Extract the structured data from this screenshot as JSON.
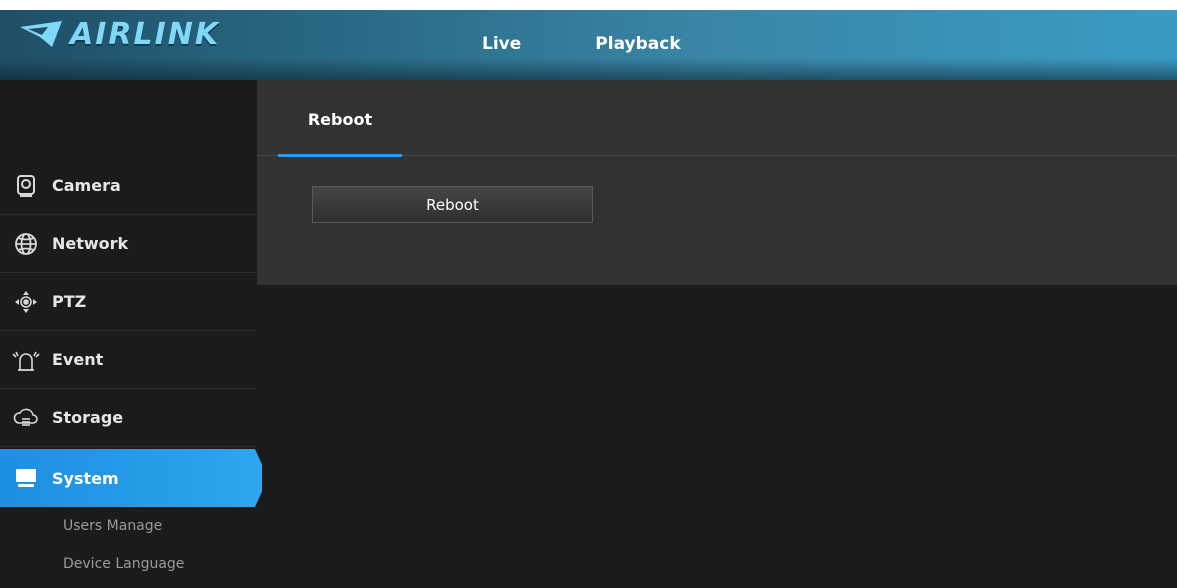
{
  "header": {
    "brand": "AIRLINK",
    "nav": [
      {
        "label": "Live"
      },
      {
        "label": "Playback"
      }
    ]
  },
  "sidebar": {
    "items": [
      {
        "label": "Camera",
        "icon": "camera-icon"
      },
      {
        "label": "Network",
        "icon": "globe-icon"
      },
      {
        "label": "PTZ",
        "icon": "ptz-icon"
      },
      {
        "label": "Event",
        "icon": "alarm-icon"
      },
      {
        "label": "Storage",
        "icon": "cloud-storage-icon"
      },
      {
        "label": "System",
        "icon": "monitor-icon",
        "active": true
      }
    ],
    "subitems": [
      {
        "label": "Users Manage"
      },
      {
        "label": "Device Language"
      }
    ]
  },
  "main": {
    "tab": {
      "label": "Reboot"
    },
    "reboot_button_label": "Reboot"
  },
  "colors": {
    "accent": "#2a9cf0",
    "header_gradient_start": "#1f4f66",
    "header_gradient_end": "#3b9bc4",
    "background": "#1b1b1b",
    "panel": "#323232"
  }
}
